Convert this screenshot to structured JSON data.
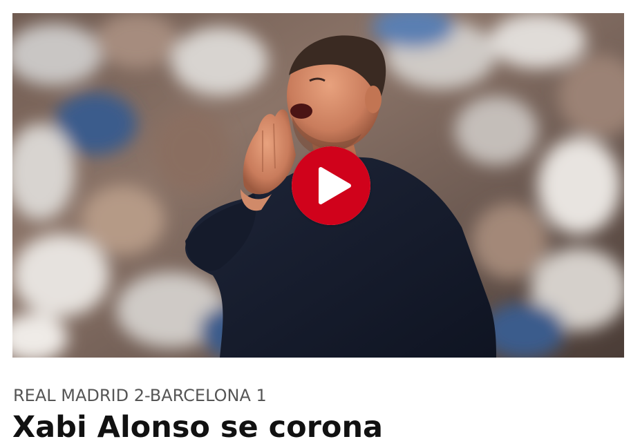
{
  "article": {
    "kicker": "REAL MADRID 2-BARCELONA 1",
    "headline": "Xabi Alonso se corona"
  },
  "media": {
    "type": "video-thumbnail",
    "subject": "man in navy jacket shouting with hand cupped to mouth, blurred stadium crowd behind",
    "play_icon": "play-icon",
    "play_color": "#d0021b"
  }
}
